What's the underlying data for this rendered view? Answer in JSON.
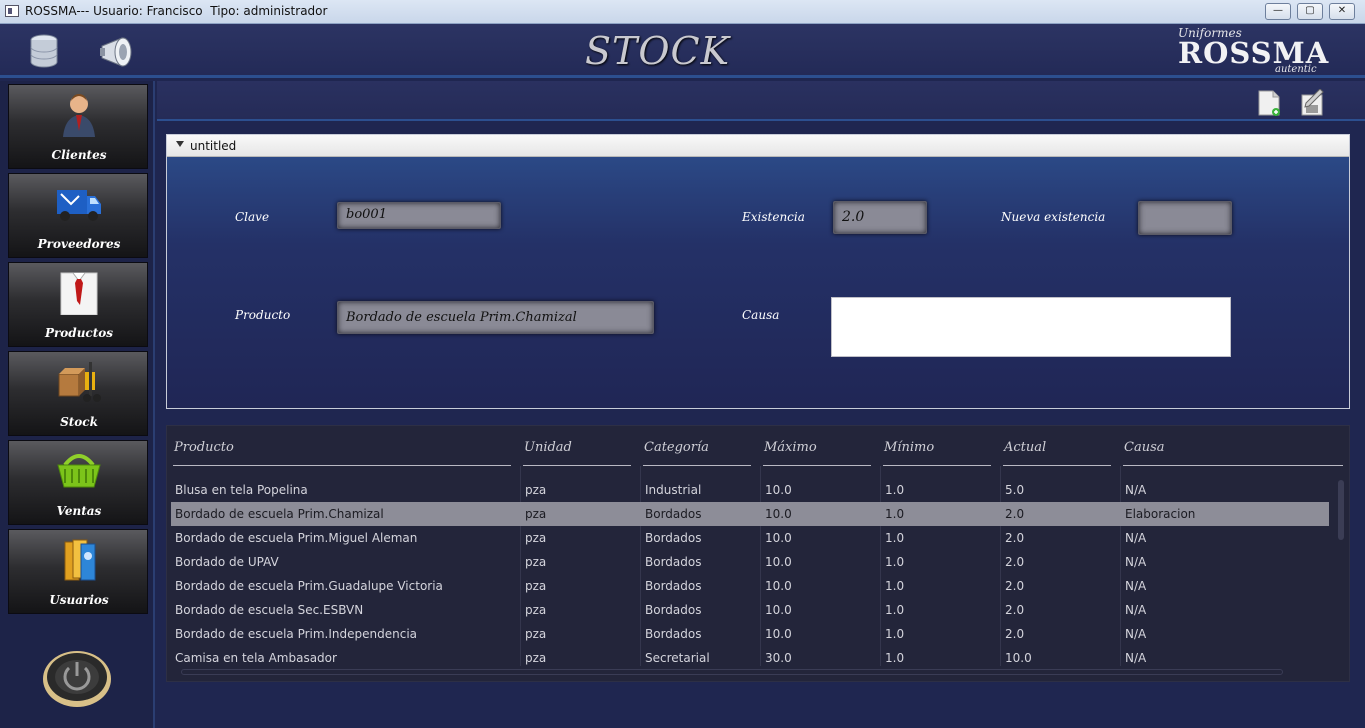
{
  "window": {
    "title": "ROSSMA--- Usuario: Francisco  Tipo: administrador",
    "minimize": "—",
    "maximize": "▢",
    "close": "✕"
  },
  "header": {
    "title": "STOCK",
    "logo": {
      "top": "Uniformes",
      "main": "ROSSMA",
      "bottom": "autentic"
    },
    "icons": [
      "database-icon",
      "megaphone-icon"
    ]
  },
  "sidebar": {
    "items": [
      {
        "label": "Clientes",
        "icon": "client-person-icon"
      },
      {
        "label": "Proveedores",
        "icon": "delivery-van-icon"
      },
      {
        "label": "Productos",
        "icon": "shirt-tie-icon"
      },
      {
        "label": "Stock",
        "icon": "forklift-boxes-icon"
      },
      {
        "label": "Ventas",
        "icon": "shopping-basket-icon"
      },
      {
        "label": "Usuarios",
        "icon": "user-folders-icon"
      }
    ],
    "power": "power-button-icon"
  },
  "toolbar": {
    "icons": [
      "new-document-icon",
      "edit-save-icon"
    ]
  },
  "form": {
    "panel_title": "untitled",
    "clave_label": "Clave",
    "clave_value": "bo001",
    "existencia_label": "Existencia",
    "existencia_value": "2.0",
    "nueva_label": "Nueva existencia",
    "nueva_value": "",
    "producto_label": "Producto",
    "producto_value": "Bordado de escuela Prim.Chamizal",
    "causa_label": "Causa",
    "causa_value": ""
  },
  "table": {
    "columns": [
      "Producto",
      "Unidad",
      "Categoría",
      "Máximo",
      "Mínimo",
      "Actual",
      "Causa"
    ],
    "selected_row": 1,
    "rows": [
      [
        "Blusa en tela Popelina",
        "pza",
        "Industrial",
        "10.0",
        "1.0",
        "5.0",
        "N/A"
      ],
      [
        "Bordado de escuela Prim.Chamizal",
        "pza",
        "Bordados",
        "10.0",
        "1.0",
        "2.0",
        "Elaboracion"
      ],
      [
        "Bordado de escuela Prim.Miguel Aleman",
        "pza",
        "Bordados",
        "10.0",
        "1.0",
        "2.0",
        "N/A"
      ],
      [
        "Bordado de UPAV",
        "pza",
        "Bordados",
        "10.0",
        "1.0",
        "2.0",
        "N/A"
      ],
      [
        "Bordado de escuela Prim.Guadalupe Victoria",
        "pza",
        "Bordados",
        "10.0",
        "1.0",
        "2.0",
        "N/A"
      ],
      [
        "Bordado de escuela Sec.ESBVN",
        "pza",
        "Bordados",
        "10.0",
        "1.0",
        "2.0",
        "N/A"
      ],
      [
        "Bordado de escuela Prim.Independencia",
        "pza",
        "Bordados",
        "10.0",
        "1.0",
        "2.0",
        "N/A"
      ],
      [
        "Camisa en tela Ambasador",
        "pza",
        "Secretarial",
        "30.0",
        "1.0",
        "10.0",
        "N/A"
      ]
    ]
  }
}
